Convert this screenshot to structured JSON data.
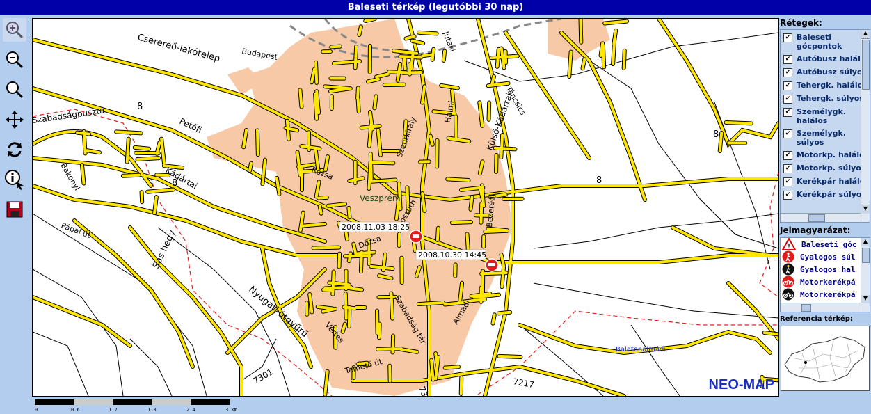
{
  "window": {
    "title": "Baleseti térkép (legutóbbi 30 nap)"
  },
  "toolbar": {
    "tools": [
      {
        "name": "zoom-in-icon"
      },
      {
        "name": "zoom-out-icon"
      },
      {
        "name": "zoom-icon"
      },
      {
        "name": "pan-icon"
      },
      {
        "name": "refresh-icon"
      },
      {
        "name": "info-icon"
      },
      {
        "name": "save-icon"
      }
    ]
  },
  "map": {
    "city_label": "Veszprém",
    "town_label": "Balatonalmádi",
    "brand": "NEO-MAP",
    "accidents": [
      {
        "label": "2008.11.03 18:25"
      },
      {
        "label": "2008.10.30 14:45"
      }
    ],
    "street_labels": {
      "s1": "Cserereő-lakótelep",
      "s2": "Szabadságpuszta",
      "s3": "Petőfi",
      "s4": "Kádártai",
      "s5": "Sas hegy",
      "s6": "Nyugati útgyűrű",
      "s7": "Külső-Kádártai",
      "s8": "Jutasi",
      "s9": "Szentkirály",
      "s10": "Bezerédj",
      "s11": "Kossuth",
      "s12": "Szabadság tér",
      "s13": "Temető út",
      "s14": "Rózsa",
      "s15": "Dózsa",
      "s16": "Almádi",
      "s17": "Halmi",
      "s18": "Vértes",
      "s19": "Budapest",
      "s20": "Bakonyi",
      "s21": "Pápai út",
      "s22": "Táncsics",
      "r8a": "8",
      "r8b": "8",
      "r8c": "8",
      "r8d": "8",
      "r7301": "7301",
      "r7217": "7217",
      "r73": "73"
    },
    "colors": {
      "road": "#ffe600",
      "urban": "#f7c9a6",
      "rail": "#888888",
      "marker": "#e31b1b"
    }
  },
  "scale": {
    "ticks": [
      "0",
      "0.6",
      "1.2",
      "1.8",
      "2.4",
      "3 km"
    ]
  },
  "layers": {
    "title": "Rétegek:",
    "items": [
      {
        "line1": "Baleseti",
        "line2": "gócpontok"
      },
      {
        "line1": "Autóbusz halálos"
      },
      {
        "line1": "Autóbusz súlyos"
      },
      {
        "line1": "Tehergk. halálos"
      },
      {
        "line1": "Tehergk. súlyos"
      },
      {
        "line1": "Személygk.",
        "line2": "halálos"
      },
      {
        "line1": "Személygk.",
        "line2": "súlyos"
      },
      {
        "line1": "Motorkp. halálos"
      },
      {
        "line1": "Motorkp. súlyos"
      },
      {
        "line1": "Kerékpár halálos"
      },
      {
        "line1": "Kerékpár súlyos"
      }
    ]
  },
  "legend": {
    "title": "Jelmagyarázat:",
    "items": [
      {
        "label": "Baleseti góc",
        "icon": "warning-triangle-icon"
      },
      {
        "label": "Gyalogos súl",
        "icon": "pedestrian-icon"
      },
      {
        "label": "Gyalogos hal",
        "icon": "pedestrian-icon"
      },
      {
        "label": "Motorkerékpá",
        "icon": "motorcycle-icon"
      },
      {
        "label": "Motorkerékpá",
        "icon": "motorcycle-icon"
      }
    ]
  },
  "reference": {
    "title": "Referencia térkép:"
  }
}
